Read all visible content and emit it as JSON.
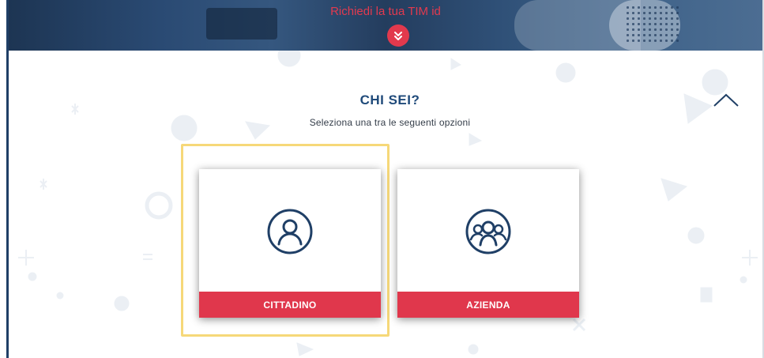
{
  "banner": {
    "title": "Richiedi la tua TIM id",
    "chevron_icon": "chevron-double-down-icon"
  },
  "section": {
    "heading": "CHI SEI?",
    "subheading": "Seleziona una tra le seguenti opzioni",
    "collapse_icon": "chevron-up-icon"
  },
  "options": [
    {
      "label": "CITTADINO",
      "icon": "user-circle-icon",
      "highlighted": true
    },
    {
      "label": "AZIENDA",
      "icon": "group-circle-icon",
      "highlighted": false
    }
  ],
  "colors": {
    "brand_red": "#e0374c",
    "heading_blue": "#1f4a7a",
    "highlight_yellow": "#f6d879"
  }
}
